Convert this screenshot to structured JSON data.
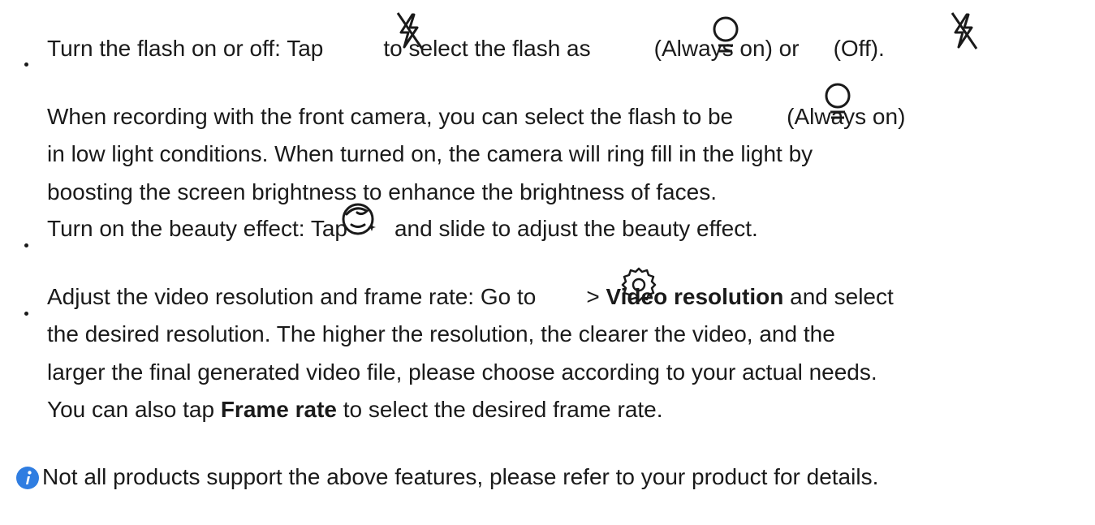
{
  "bullet_flash": {
    "text_before_icon": "Turn the flash on or off: Tap",
    "text_after_icon": "to select the flash as",
    "always_on_label": "(Always on) or",
    "off_label": "(Off).",
    "icons": [
      "flash-off-icon",
      "bulb-icon",
      "flash-off-icon"
    ]
  },
  "flash_note": {
    "line1_before_icon": "When recording with the front camera, you can select the flash to be",
    "line1_after_icon": "(Always on)",
    "line2": "in low light conditions. When turned on, the camera will ring fill in the light by",
    "line3": "boosting the screen brightness to enhance the brightness of faces.",
    "icons": [
      "bulb-icon"
    ]
  },
  "bullet_beauty": {
    "text_before_icon": "Turn on the beauty effect: Tap",
    "text_after_icon": "and slide to adjust the beauty effect.",
    "icons": [
      "beauty-face-icon"
    ]
  },
  "bullet_resolution": {
    "line1_before_icon": "Adjust the video resolution and frame rate: Go to",
    "line1_separator": ">",
    "line1_bold": "Video resolution",
    "line1_after_bold": "and select",
    "line2": "the desired resolution. The higher the resolution, the clearer the video, and the",
    "line3": "larger the final generated video file, please choose according to your actual needs.",
    "line4_before_bold": "You can also tap",
    "line4_bold": "Frame rate",
    "line4_after_bold": "to select the desired frame rate.",
    "icons": [
      "settings-gear-icon"
    ]
  },
  "note": {
    "icon": "info-icon",
    "icon_color": "#2f7de1",
    "text": "Not all products support the above features, please refer to your product for details."
  }
}
